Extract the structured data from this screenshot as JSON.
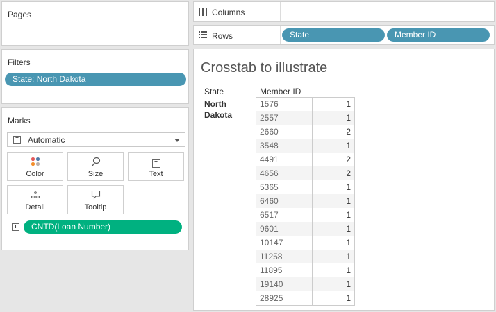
{
  "pages": {
    "title": "Pages"
  },
  "filters": {
    "title": "Filters",
    "pills": [
      {
        "label": "State: North Dakota",
        "color": "#4996b2"
      }
    ]
  },
  "marks": {
    "title": "Marks",
    "type_selected": "Automatic",
    "buttons": [
      {
        "label": "Color",
        "icon": "color-dots-icon"
      },
      {
        "label": "Size",
        "icon": "size-lasso-icon"
      },
      {
        "label": "Text",
        "icon": "text-t-icon"
      },
      {
        "label": "Detail",
        "icon": "detail-dots-icon"
      },
      {
        "label": "Tooltip",
        "icon": "tooltip-bubble-icon"
      }
    ],
    "fields": [
      {
        "label": "CNTD(Loan Number)",
        "color": "#00b180",
        "icon": "text-t-icon"
      }
    ]
  },
  "shelves": {
    "columns": {
      "label": "Columns",
      "icon": "columns-icon"
    },
    "rows": {
      "label": "Rows",
      "icon": "rows-icon",
      "pills": [
        {
          "label": "State",
          "color": "#4996b2"
        },
        {
          "label": "Member ID",
          "color": "#4996b2"
        }
      ]
    }
  },
  "view": {
    "title": "Crosstab to illustrate",
    "headers": {
      "state": "State",
      "member_id": "Member ID"
    },
    "state_value": "North Dakota",
    "rows": [
      {
        "member_id": "1576",
        "count": "1"
      },
      {
        "member_id": "2557",
        "count": "1"
      },
      {
        "member_id": "2660",
        "count": "2"
      },
      {
        "member_id": "3548",
        "count": "1"
      },
      {
        "member_id": "4491",
        "count": "2"
      },
      {
        "member_id": "4656",
        "count": "2"
      },
      {
        "member_id": "5365",
        "count": "1"
      },
      {
        "member_id": "6460",
        "count": "1"
      },
      {
        "member_id": "6517",
        "count": "1"
      },
      {
        "member_id": "9601",
        "count": "1"
      },
      {
        "member_id": "10147",
        "count": "1"
      },
      {
        "member_id": "11258",
        "count": "1"
      },
      {
        "member_id": "11895",
        "count": "1"
      },
      {
        "member_id": "19140",
        "count": "1"
      },
      {
        "member_id": "28925",
        "count": "1"
      }
    ]
  }
}
